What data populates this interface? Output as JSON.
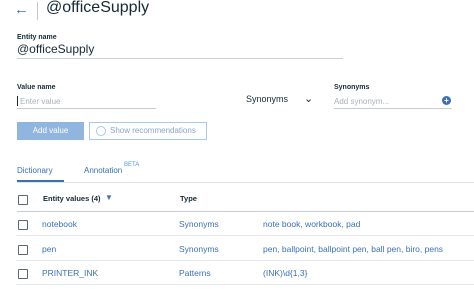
{
  "header": {
    "title": "@officeSupply"
  },
  "entity": {
    "label": "Entity name",
    "value": "@officeSupply"
  },
  "value_row": {
    "value_label": "Value name",
    "value_placeholder": "Enter value",
    "type_selected": "Synonyms",
    "synonyms_label": "Synonyms",
    "synonyms_placeholder": "Add synonym..."
  },
  "buttons": {
    "add_value": "Add value",
    "show_recommendations": "Show recommendations"
  },
  "tabs": [
    {
      "label": "Dictionary",
      "active": true
    },
    {
      "label": "Annotation",
      "badge": "BETA"
    }
  ],
  "table": {
    "header_values": "Entity values (4)",
    "header_type": "Type",
    "rows": [
      {
        "value": "notebook",
        "type": "Synonyms",
        "synonyms": "note book, workbook, pad"
      },
      {
        "value": "pen",
        "type": "Synonyms",
        "synonyms": "pen, ballpoint, ballpoint pen, ball pen, biro, pens"
      },
      {
        "value": "PRINTER_INK",
        "type": "Patterns",
        "synonyms": "(INK)\\d{1,3}"
      }
    ]
  },
  "colors": {
    "accent": "#3d70b2",
    "button_disabled": "#90b6e0"
  }
}
